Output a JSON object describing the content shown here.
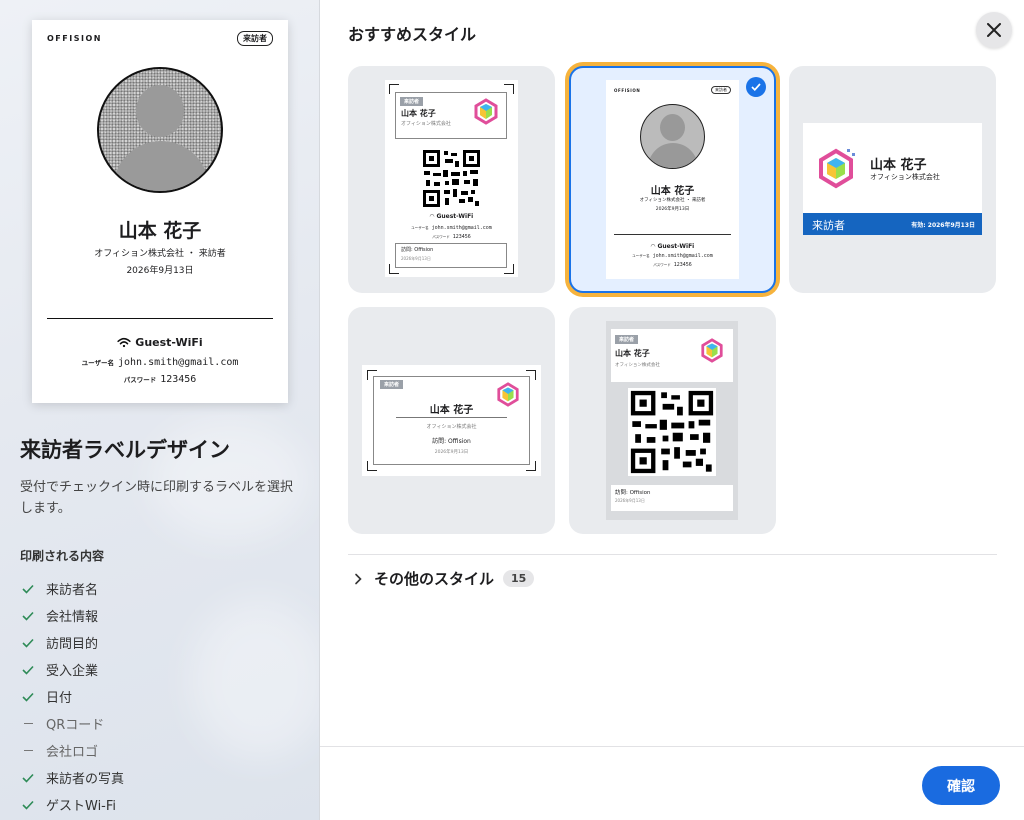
{
  "preview": {
    "brand": "OFFISION",
    "badge": "来訪者",
    "name": "山本 花子",
    "company": "オフィション株式会社 ・ 来訪者",
    "date": "2026年9月13日",
    "wifi_label": "Guest-WiFi",
    "user_key": "ユーザー名",
    "user_val": "john.smith@gmail.com",
    "pass_key": "パスワード",
    "pass_val": "123456"
  },
  "left": {
    "title": "来訪者ラベルデザイン",
    "description": "受付でチェックイン時に印刷するラベルを選択します。",
    "printed_heading": "印刷される内容",
    "items": [
      {
        "label": "来訪者名",
        "on": true
      },
      {
        "label": "会社情報",
        "on": true
      },
      {
        "label": "訪問目的",
        "on": true
      },
      {
        "label": "受入企業",
        "on": true
      },
      {
        "label": "日付",
        "on": true
      },
      {
        "label": "QRコード",
        "on": false
      },
      {
        "label": "会社ロゴ",
        "on": false
      },
      {
        "label": "来訪者の写真",
        "on": true
      },
      {
        "label": "ゲストWi-Fi",
        "on": true
      }
    ]
  },
  "right": {
    "heading": "おすすめスタイル",
    "more_label": "その他のスタイル",
    "more_count": "15",
    "confirm_label": "確認"
  },
  "tiles": {
    "t1": {
      "tag": "来訪者",
      "name": "山本 花子",
      "company": "オフィション株式会社",
      "wifi": "Guest-WiFi",
      "user_key": "ユーザー名",
      "user_val": "john.smith@gmail.com",
      "pass_key": "パスワード",
      "pass_val": "123456",
      "visit": "訪問: Offision",
      "date": "2026年9月13日"
    },
    "t2": {
      "brand": "OFFISION",
      "badge": "来訪者",
      "name": "山本 花子",
      "company": "オフィション株式会社 ・ 来訪者",
      "date": "2026年9月13日",
      "wifi": "Guest-WiFi",
      "user_key": "ユーザー名",
      "user_val": "john.smith@gmail.com",
      "pass_key": "パスワード",
      "pass_val": "123456"
    },
    "t3": {
      "name": "山本 花子",
      "company": "オフィション株式会社",
      "visitor": "来訪者",
      "valid": "有効: 2026年9月13日"
    },
    "t4": {
      "tag": "来訪者",
      "name": "山本 花子",
      "company": "オフィション株式会社",
      "visit": "訪問: Offision",
      "date": "2026年9月13日"
    },
    "t5": {
      "tag": "来訪者",
      "name": "山本 花子",
      "company": "オフィション株式会社",
      "visit": "訪問: Offision",
      "date": "2026年9月13日"
    }
  },
  "colors": {
    "accent": "#1a6be0",
    "selection_ring": "#f6b33d",
    "visitor_bar": "#1565c0"
  }
}
